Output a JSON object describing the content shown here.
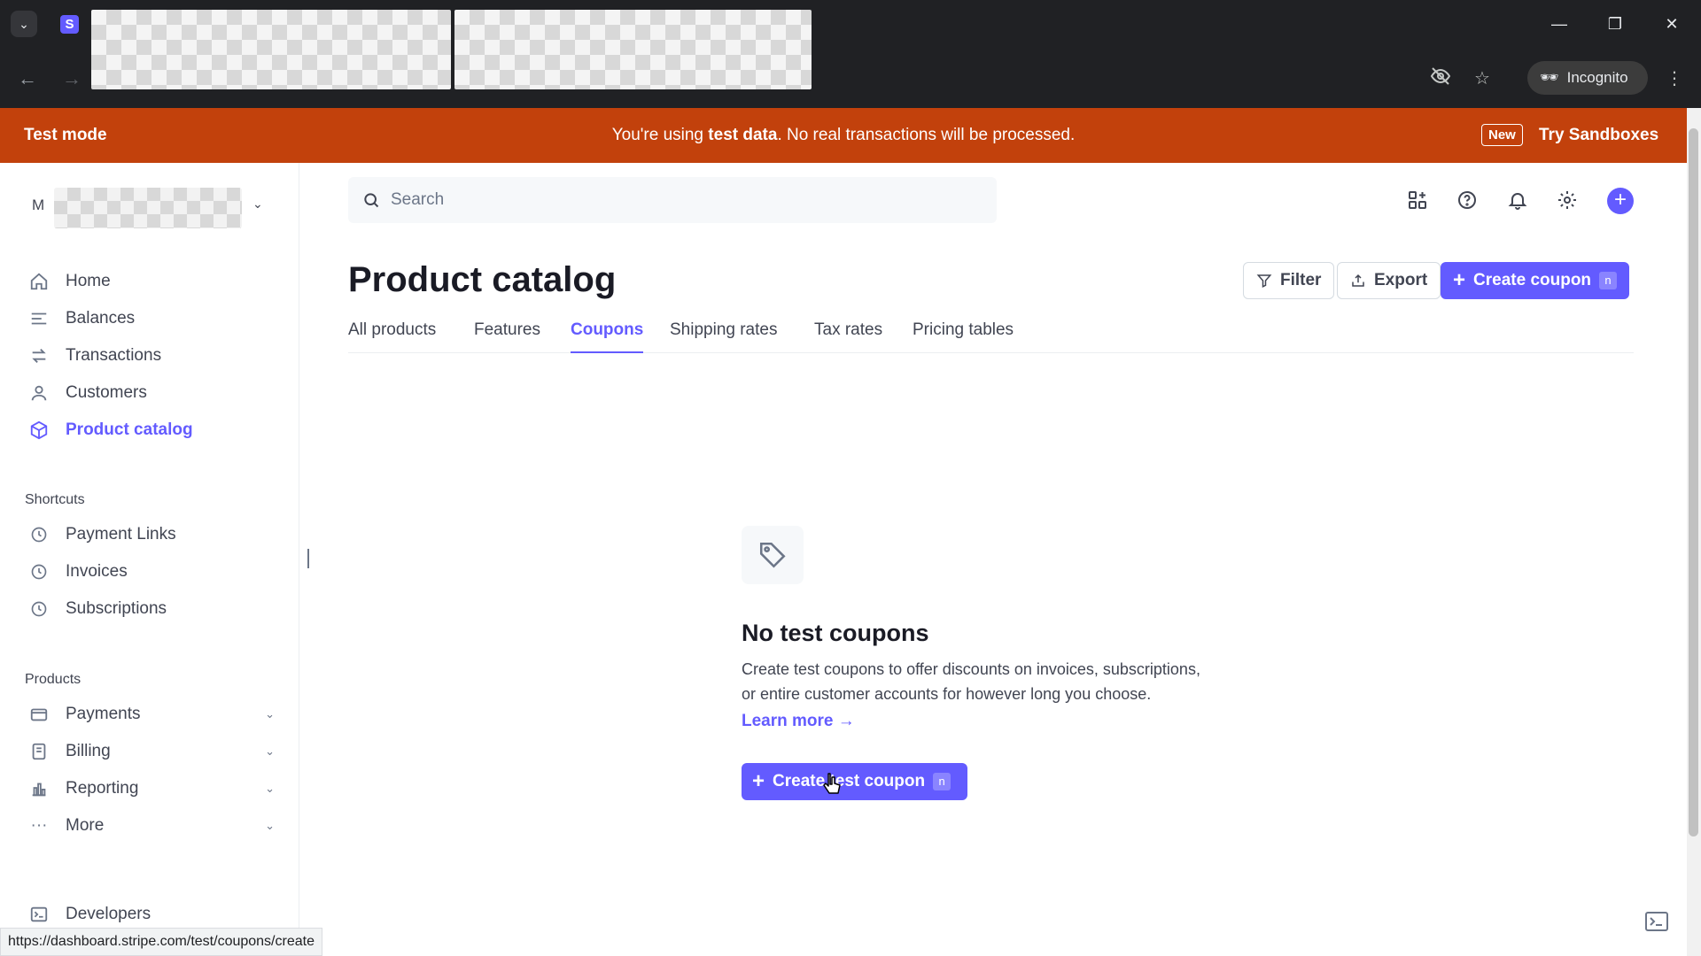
{
  "browser": {
    "incognito_label": "Incognito"
  },
  "banner": {
    "left": "Test mode",
    "center_prefix": "You're using ",
    "center_bold": "test data",
    "center_suffix": ". No real transactions will be processed.",
    "new_badge": "New",
    "sandbox_link": "Try Sandboxes"
  },
  "sidebar": {
    "account_initial": "M",
    "items": [
      {
        "label": "Home",
        "icon": "home-icon"
      },
      {
        "label": "Balances",
        "icon": "balances-icon"
      },
      {
        "label": "Transactions",
        "icon": "transactions-icon"
      },
      {
        "label": "Customers",
        "icon": "customers-icon"
      },
      {
        "label": "Product catalog",
        "icon": "product-icon",
        "active": true
      }
    ],
    "shortcuts_heading": "Shortcuts",
    "shortcuts": [
      {
        "label": "Payment Links",
        "icon": "clock-icon"
      },
      {
        "label": "Invoices",
        "icon": "clock-icon"
      },
      {
        "label": "Subscriptions",
        "icon": "clock-icon"
      }
    ],
    "products_heading": "Products",
    "products": [
      {
        "label": "Payments",
        "icon": "payments-icon"
      },
      {
        "label": "Billing",
        "icon": "billing-icon"
      },
      {
        "label": "Reporting",
        "icon": "reporting-icon"
      },
      {
        "label": "More",
        "icon": "more-icon"
      }
    ],
    "developers": "Developers"
  },
  "header": {
    "search_placeholder": "Search"
  },
  "page": {
    "title": "Product catalog",
    "filter_label": "Filter",
    "export_label": "Export",
    "create_label": "Create coupon",
    "create_shortcut": "n",
    "tabs": [
      "All products",
      "Features",
      "Coupons",
      "Shipping rates",
      "Tax rates",
      "Pricing tables"
    ],
    "active_tab": "Coupons"
  },
  "empty_state": {
    "title": "No test coupons",
    "desc_line1": "Create test coupons to offer discounts on invoices, subscriptions,",
    "desc_line2": "or entire customer accounts for however long you choose.",
    "learn_more": "Learn more →",
    "cta_label": "Create test coupon",
    "cta_shortcut": "n"
  },
  "status_bar": {
    "url": "https://dashboard.stripe.com/test/coupons/create"
  },
  "colors": {
    "accent": "#635bff",
    "banner": "#c2410c"
  }
}
